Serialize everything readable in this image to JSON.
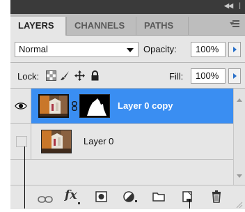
{
  "panel": {
    "collapse_glyph": "◀◀",
    "close_glyph": "✕",
    "tabs": [
      {
        "label": "LAYERS"
      },
      {
        "label": "CHANNELS"
      },
      {
        "label": "PATHS"
      }
    ],
    "panel_menu_icon": "panel-menu-icon"
  },
  "blend": {
    "mode": "Normal"
  },
  "opacity": {
    "label": "Opacity:",
    "value": "100%"
  },
  "lock": {
    "label": "Lock:",
    "icons": [
      "lock-transparent-pixels-icon",
      "lock-image-pixels-icon",
      "lock-position-icon",
      "lock-all-icon"
    ]
  },
  "fill": {
    "label": "Fill:",
    "value": "100%"
  },
  "layers": [
    {
      "name": "Layer 0 copy",
      "selected": true,
      "visible": true,
      "has_mask": true
    },
    {
      "name": "Layer 0",
      "selected": false,
      "visible": false,
      "has_mask": false
    }
  ],
  "bottom_icons": [
    "link-layers-icon",
    "layer-style-fx-icon",
    "add-layer-mask-icon",
    "adjustment-layer-icon",
    "new-group-icon",
    "new-layer-icon",
    "delete-layer-icon"
  ],
  "fx_label": "fx",
  "colors": {
    "selection": "#3a8ef2",
    "panel_bg": "#e6e6e6",
    "tab_bar": "#bdbdbd",
    "title_bar": "#3a3a3a",
    "arrow_blue": "#2a70c8"
  }
}
